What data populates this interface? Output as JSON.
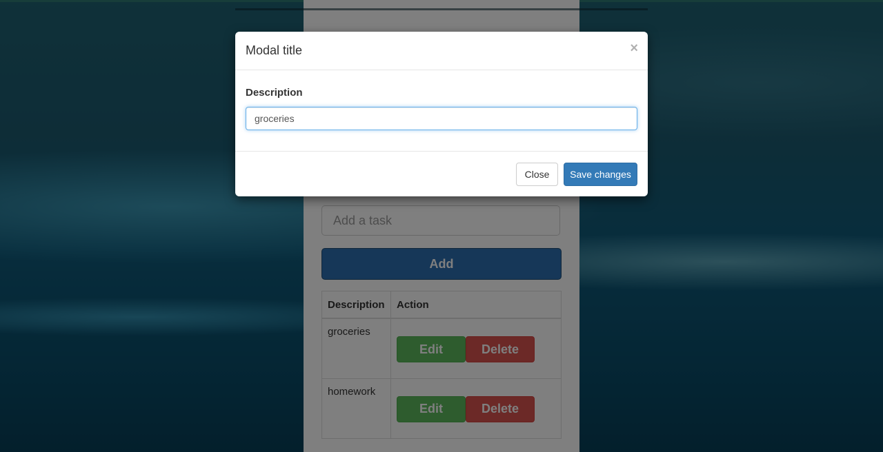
{
  "background": {
    "colors": {
      "sky_top": "#1f6273",
      "sea_bottom": "#073f58"
    }
  },
  "app": {
    "task_input": {
      "placeholder": "Add a task",
      "value": ""
    },
    "add_button": {
      "label": "Add",
      "color": "#2c6fb1"
    },
    "table": {
      "headers": [
        "Description",
        "Action"
      ],
      "rows": [
        {
          "description": "groceries",
          "edit_label": "Edit",
          "delete_label": "Delete"
        },
        {
          "description": "homework",
          "edit_label": "Edit",
          "delete_label": "Delete"
        }
      ]
    }
  },
  "modal": {
    "title": "Modal title",
    "close_icon": "close-icon",
    "close_glyph": "×",
    "field_label": "Description",
    "field_value": "groceries",
    "buttons": {
      "close_label": "Close",
      "save_label": "Save changes",
      "save_color": "#337ab7"
    }
  }
}
